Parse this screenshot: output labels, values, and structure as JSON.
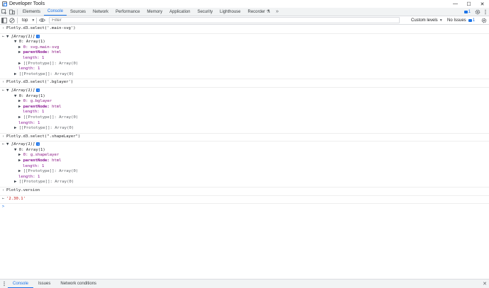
{
  "window": {
    "title": "Developer Tools",
    "minimize": "—",
    "maximize": "☐",
    "close": "✕"
  },
  "tabs": [
    "Elements",
    "Console",
    "Sources",
    "Network",
    "Performance",
    "Memory",
    "Application",
    "Security",
    "Lighthouse",
    "Recorder ⚗"
  ],
  "tabbar": {
    "more": "»",
    "messages_count": "1",
    "settings_icon": "gear-icon",
    "menu_icon": "kebab-icon"
  },
  "console_toolbar": {
    "context": "top",
    "filter_placeholder": "Filter",
    "levels": "Custom levels",
    "issues": "No Issues",
    "issues_count": "1"
  },
  "console": {
    "entries": [
      {
        "input": "Plotly.d3.select('.main-svg')",
        "out_header": "[Array(1)]",
        "el0": "0: Array(1)",
        "child": "0: svg.main-svg",
        "parent_key": "parentNode:",
        "parent_val": "html",
        "length_inner": "length: 1",
        "proto_inner": "[[Prototype]]: Array(0)",
        "length_outer": "length: 1",
        "proto_outer": "[[Prototype]]: Array(0)"
      },
      {
        "input": "Plotly.d3.select('.bglayer')",
        "out_header": "[Array(1)]",
        "el0": "0: Array(1)",
        "child": "0: g.bglayer",
        "parent_key": "parentNode:",
        "parent_val": "html",
        "length_inner": "length: 1",
        "proto_inner": "[[Prototype]]: Array(0)",
        "length_outer": "length: 1",
        "proto_outer": "[[Prototype]]: Array(0)"
      },
      {
        "input": "Plotly.d3.select(\".shapeLayer\")",
        "out_header": "[Array(1)]",
        "el0": "0: Array(1)",
        "child": "0: g.shapelayer",
        "parent_key": "parentNode:",
        "parent_val": "html",
        "length_inner": "length: 1",
        "proto_inner": "[[Prototype]]: Array(0)",
        "length_outer": "length: 1",
        "proto_outer": "[[Prototype]]: Array(0)"
      }
    ],
    "version_input": "Plotly.version",
    "version_output": "'2.30.1'",
    "prompt": ">"
  },
  "drawer": {
    "tabs": [
      "Console",
      "Issues",
      "Network conditions"
    ],
    "close": "✕"
  }
}
